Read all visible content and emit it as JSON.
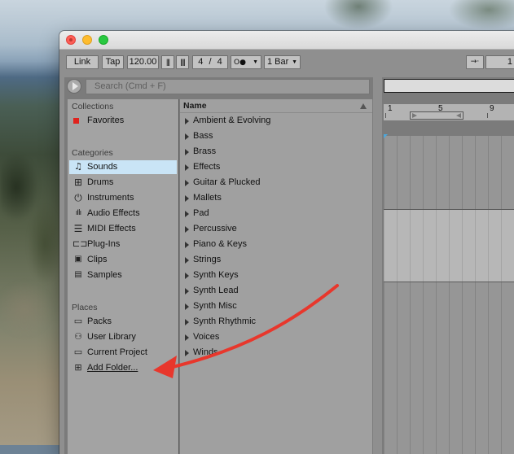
{
  "toolbar": {
    "link": "Link",
    "tap": "Tap",
    "tempo": "120.00",
    "sig_num": "4",
    "sig_sep": "/",
    "sig_den": "4",
    "metronome": "O●",
    "quantize": "1 Bar",
    "right_value": "1"
  },
  "browser": {
    "search_placeholder": "Search (Cmd + F)",
    "collections_label": "Collections",
    "favorites": "Favorites",
    "categories_label": "Categories",
    "categories": [
      "Sounds",
      "Drums",
      "Instruments",
      "Audio Effects",
      "MIDI Effects",
      "Plug-Ins",
      "Clips",
      "Samples"
    ],
    "places_label": "Places",
    "places": [
      "Packs",
      "User Library",
      "Current Project",
      "Add Folder..."
    ],
    "column_header": "Name",
    "items": [
      "Ambient & Evolving",
      "Bass",
      "Brass",
      "Effects",
      "Guitar & Plucked",
      "Mallets",
      "Pad",
      "Percussive",
      "Piano & Keys",
      "Strings",
      "Synth Keys",
      "Synth Lead",
      "Synth Misc",
      "Synth Rhythmic",
      "Voices",
      "Winds"
    ]
  },
  "arrangement": {
    "ruler": [
      "1",
      "5",
      "9"
    ]
  },
  "colors": {
    "selection": "#c9e4f6",
    "favorite": "#e0221d",
    "annotation_arrow": "#e8372c"
  },
  "icons": {
    "sounds": "music-note-icon",
    "drums": "drum-grid-icon",
    "instruments": "power-icon",
    "audio_effects": "waveform-icon",
    "midi_effects": "sliders-icon",
    "plugins": "plug-icon",
    "clips": "play-box-icon",
    "samples": "samples-icon"
  }
}
